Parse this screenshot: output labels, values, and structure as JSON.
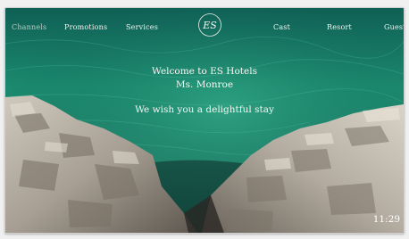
{
  "nav": {
    "left": [
      "Channels",
      "Promotions",
      "Services"
    ],
    "right": [
      "Cast",
      "Resort",
      "Guest"
    ],
    "active": "Channels"
  },
  "logo": {
    "text": "ES",
    "icon": "es-hotels-logo-icon"
  },
  "welcome": {
    "line1": "Welcome to ES Hotels",
    "line2": "Ms. Monroe",
    "line3": "We wish you a delightful stay"
  },
  "status": {
    "time": "11:29"
  },
  "colors": {
    "sea": "#1f7a66",
    "rock": "#b9b2a6",
    "text": "#f4f4f0"
  }
}
